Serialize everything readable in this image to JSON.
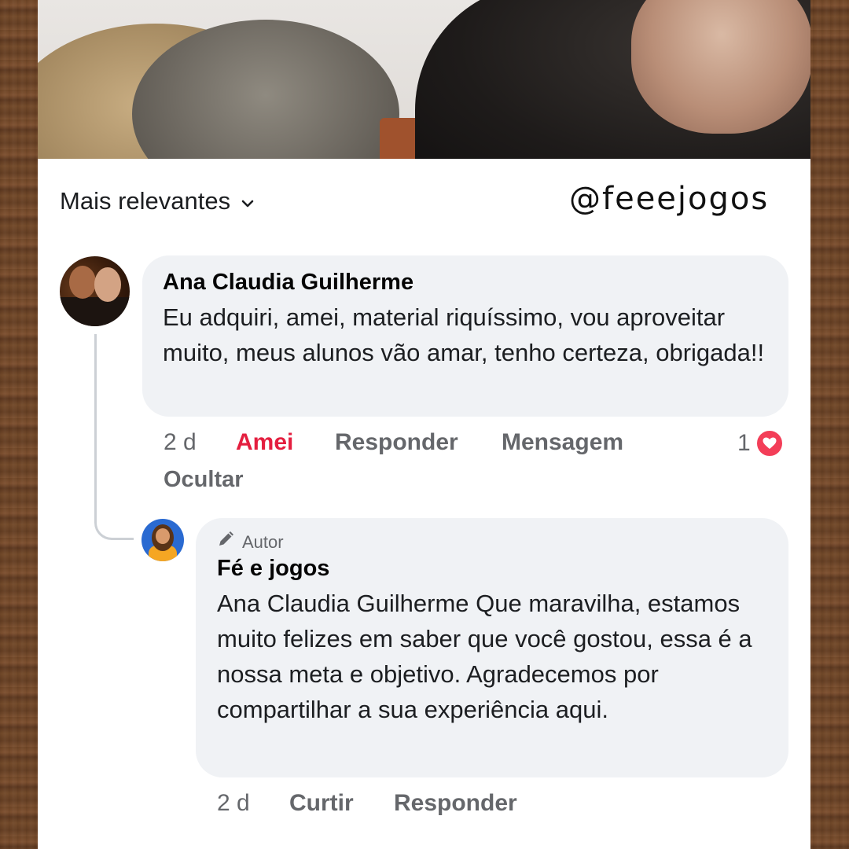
{
  "header": {
    "sort_label": "Mais relevantes",
    "sort_icon": "chevron-down-icon",
    "handle": "@feeejogos"
  },
  "comment": {
    "author": "Ana Claudia Guilherme",
    "text": "Eu adquiri,  amei, material riquíssimo,  vou aproveitar muito, meus alunos vão amar, tenho certeza, obrigada!!",
    "time": "2 d",
    "reaction_action": "Amei",
    "reply_action": "Responder",
    "message_action": "Mensagem",
    "hide_action": "Ocultar",
    "reaction_count": "1",
    "reaction_icon": "heart-icon",
    "reaction_color": "#f33e58",
    "loved_color": "#e41e3f"
  },
  "reply": {
    "badge": "Autor",
    "badge_icon": "pencil-icon",
    "author": "Fé e jogos",
    "text": "Ana Claudia Guilherme Que maravilha, estamos muito felizes em saber que você gostou, essa é a nossa meta e objetivo. Agradecemos por compartilhar a sua experiência aqui.",
    "time": "2 d",
    "like_action": "Curtir",
    "reply_action": "Responder"
  },
  "colors": {
    "bubble": "#f0f2f5",
    "secondary_text": "#65676b",
    "primary_text": "#050505"
  }
}
